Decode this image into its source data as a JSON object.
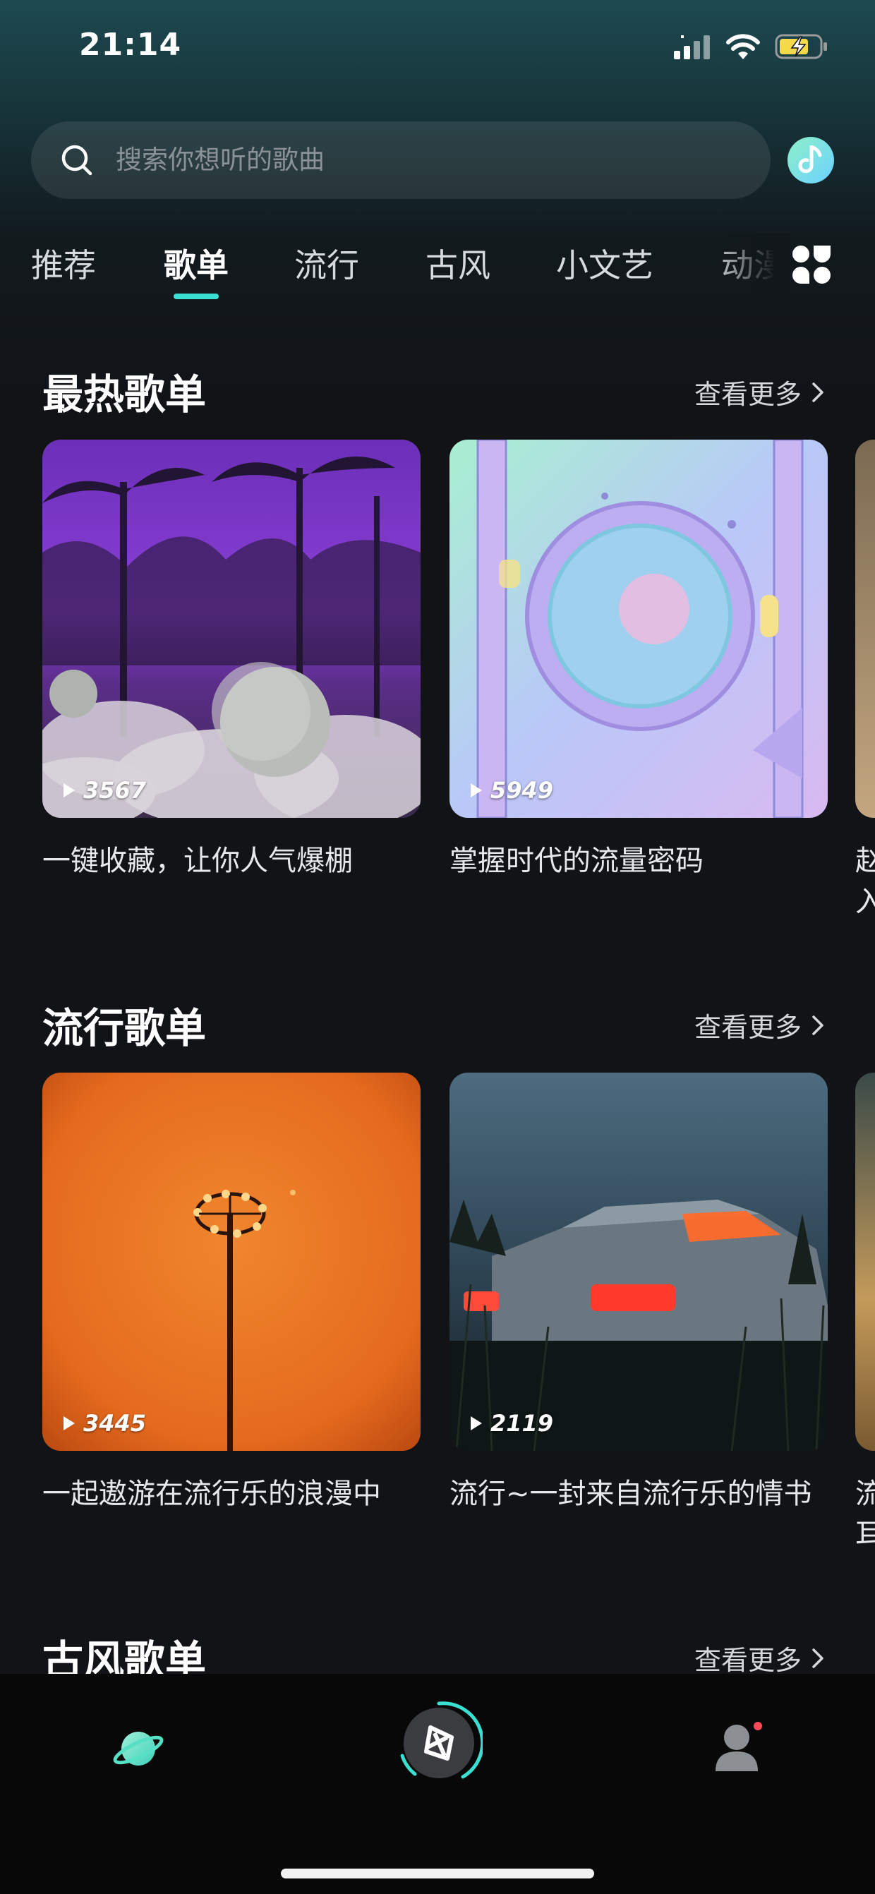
{
  "status_bar": {
    "time": "21:14"
  },
  "search": {
    "placeholder": "搜索你想听的歌曲"
  },
  "tabs": [
    {
      "label": "推荐",
      "active": false
    },
    {
      "label": "歌单",
      "active": true
    },
    {
      "label": "流行",
      "active": false
    },
    {
      "label": "古风",
      "active": false
    },
    {
      "label": "小文艺",
      "active": false
    },
    {
      "label": "动漫",
      "active": false
    }
  ],
  "sections": [
    {
      "title": "最热歌单",
      "more": "查看更多",
      "cards": [
        {
          "title": "一键收藏，让你人气爆棚",
          "plays": "3567"
        },
        {
          "title": "掌握时代的流量密码",
          "plays": "5949"
        }
      ],
      "peek_title": "赵\n入"
    },
    {
      "title": "流行歌单",
      "more": "查看更多",
      "cards": [
        {
          "title": "一起遨游在流行乐的浪漫中",
          "plays": "3445"
        },
        {
          "title": "流行~一封来自流行乐的情书",
          "plays": "2119"
        }
      ],
      "peek_title": "流\n耳"
    },
    {
      "title": "古风歌单",
      "more": "查看更多"
    }
  ],
  "colors": {
    "accent": "#39e0d2",
    "background": "#111317",
    "badge": "#ff4a55"
  },
  "icons": {
    "search": "search-icon",
    "music": "music-note-icon",
    "categories": "grid-icon",
    "play": "play-icon",
    "explore": "planet-icon",
    "player": "vinyl-icon",
    "profile": "user-icon"
  }
}
